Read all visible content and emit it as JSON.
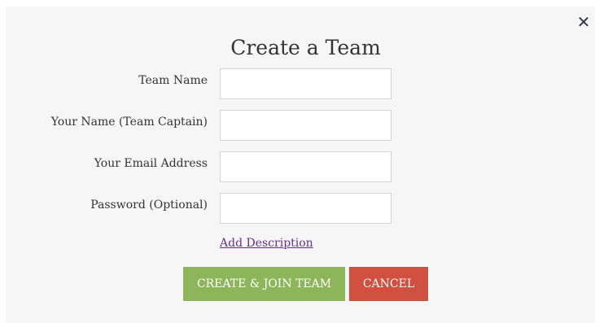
{
  "dialog": {
    "title": "Create a Team",
    "close_symbol": "✕",
    "close_icon": "close-icon"
  },
  "form": {
    "fields": [
      {
        "label": "Team Name",
        "value": "",
        "placeholder": ""
      },
      {
        "label": "Your Name (Team Captain)",
        "value": "",
        "placeholder": ""
      },
      {
        "label": "Your Email Address",
        "value": "",
        "placeholder": ""
      },
      {
        "label": "Password (Optional)",
        "value": "",
        "placeholder": ""
      }
    ],
    "add_description_link": "Add Description"
  },
  "actions": {
    "create_label": "CREATE & JOIN TEAM",
    "cancel_label": "CANCEL"
  },
  "colors": {
    "create_button": "#8db55a",
    "cancel_button": "#d2503f",
    "link": "#6b2c91",
    "modal_background": "#f6f6f6"
  }
}
